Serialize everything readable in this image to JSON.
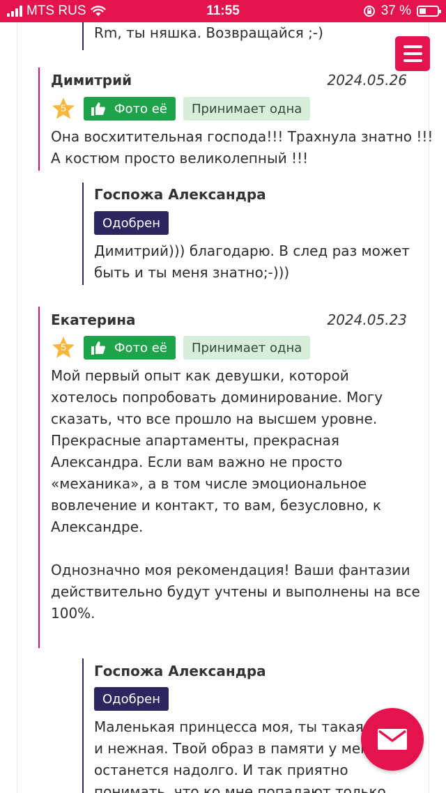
{
  "status_bar": {
    "carrier": "MTS RUS",
    "time": "11:55",
    "battery": "37 %"
  },
  "colors": {
    "accent": "#e5134d",
    "navy": "#2b2560",
    "green": "#1ea24a",
    "light_green": "#d6eedb",
    "star": "#f6b73c"
  },
  "menu": {
    "icon": "hamburger-menu-icon"
  },
  "top_reply": {
    "text": "Rm, ты няшка. Возвращайся ;-)"
  },
  "reviews": [
    {
      "author": "Димитрий",
      "date": "2024.05.26",
      "rating": "5",
      "photo_label": "Фото её",
      "tag": "Принимает одна",
      "text": [
        "Она восхитительная господа!!! Трахнула знатно !!!",
        "А костюм просто великолепный !!!"
      ],
      "reply": {
        "author": "Госпожа Александра",
        "status": "Одобрен",
        "text": [
          "Димитрий))) благодарю. В след раз может",
          "быть и ты меня знатно;-)))"
        ]
      }
    },
    {
      "author": "Екатерина",
      "date": "2024.05.23",
      "rating": "5",
      "photo_label": "Фото её",
      "tag": "Принимает одна",
      "text": [
        "Мой первый опыт как девушки, которой",
        "хотелось попробовать доминирование. Могу",
        "сказать, что все прошло на высшем уровне.",
        "Прекрасные апартаменты, прекрасная",
        "Александра. Если вам важно не просто",
        "«механика», а в том числе эмоциональное",
        "вовлечение и контакт, то вам, безусловно, к",
        "Александре.",
        "",
        "Однозначно моя рекомендация! Ваши фантазии",
        "действительно будут учтены и выполнены на все",
        "100%."
      ],
      "reply": {
        "author": "Госпожа Александра",
        "status": "Одобрен",
        "text": [
          "Маленькая принцесса моя, ты такая м",
          "и нежная. Твой образ в памяти у меня",
          "останется надолго. И так приятно",
          "понимать, что ко мне попадают только"
        ]
      }
    }
  ],
  "mail_button": {
    "icon": "envelope-icon"
  }
}
